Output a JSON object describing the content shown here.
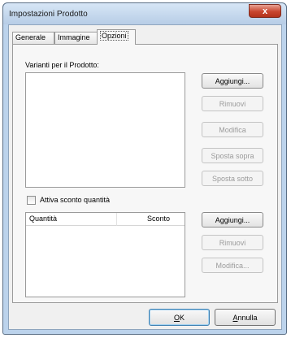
{
  "window": {
    "title": "Impostazioni Prodotto",
    "close_glyph": "x"
  },
  "tabs": [
    {
      "label": "Generale",
      "active": false
    },
    {
      "label": "Immagine",
      "active": false
    },
    {
      "label": "Opzioni",
      "active": true
    }
  ],
  "variants": {
    "label": "Varianti per il Prodotto:",
    "items": [],
    "buttons": {
      "add": "Aggiungi...",
      "remove": "Rimuovi",
      "edit": "Modifica",
      "move_up": "Sposta sopra",
      "move_down": "Sposta sotto"
    }
  },
  "discount": {
    "checkbox_label": "Attiva sconto quantità",
    "checked": false,
    "columns": [
      "Quantità",
      "Sconto"
    ],
    "rows": [],
    "buttons": {
      "add": "Aggiungi...",
      "remove": "Rimuovi",
      "edit": "Modifica..."
    }
  },
  "footer": {
    "ok_accel": "O",
    "ok_rest": "K",
    "cancel_accel": "A",
    "cancel_rest": "nnulla"
  }
}
